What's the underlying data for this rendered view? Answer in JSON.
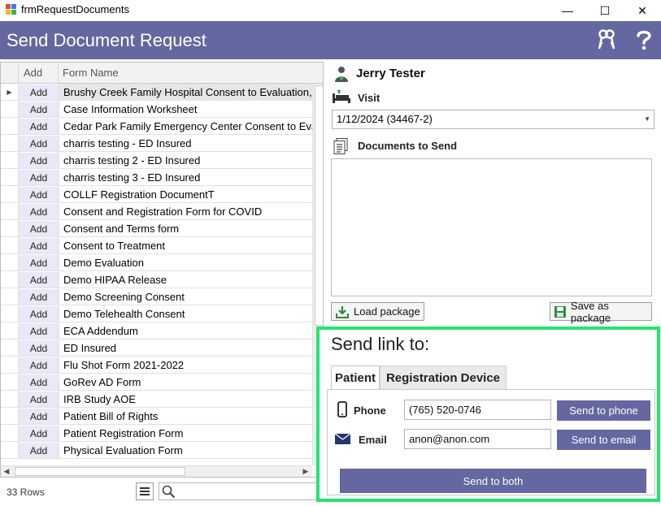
{
  "window": {
    "title": "frmRequestDocuments",
    "minimize": "—",
    "maximize": "☐",
    "close": "✕"
  },
  "header": {
    "title": "Send Document Request",
    "icons": [
      "keys-icon",
      "help-icon"
    ],
    "accent": "#6567a0"
  },
  "grid": {
    "columns": {
      "add": "Add",
      "form_name": "Form Name"
    },
    "row_marker": "▶",
    "rows": [
      {
        "add": "Add",
        "name": "Brushy Creek Family Hospital Consent to Evaluation, I"
      },
      {
        "add": "Add",
        "name": "Case Information Worksheet"
      },
      {
        "add": "Add",
        "name": "Cedar Park  Family Emergency Center Consent to Eva"
      },
      {
        "add": "Add",
        "name": "charris testing - ED Insured"
      },
      {
        "add": "Add",
        "name": "charris testing 2 - ED Insured"
      },
      {
        "add": "Add",
        "name": "charris testing 3 - ED Insured"
      },
      {
        "add": "Add",
        "name": "COLLF Registration DocumentT"
      },
      {
        "add": "Add",
        "name": "Consent and Registration Form for COVID"
      },
      {
        "add": "Add",
        "name": "Consent and Terms form"
      },
      {
        "add": "Add",
        "name": "Consent to Treatment"
      },
      {
        "add": "Add",
        "name": "Demo Evaluation"
      },
      {
        "add": "Add",
        "name": "Demo HIPAA Release"
      },
      {
        "add": "Add",
        "name": "Demo Screening Consent"
      },
      {
        "add": "Add",
        "name": "Demo Telehealth Consent"
      },
      {
        "add": "Add",
        "name": "ECA Addendum"
      },
      {
        "add": "Add",
        "name": "ED Insured"
      },
      {
        "add": "Add",
        "name": "Flu Shot Form 2021-2022"
      },
      {
        "add": "Add",
        "name": "GoRev AD Form"
      },
      {
        "add": "Add",
        "name": "IRB Study AOE"
      },
      {
        "add": "Add",
        "name": "Patient Bill of Rights"
      },
      {
        "add": "Add",
        "name": "Patient Registration Form"
      },
      {
        "add": "Add",
        "name": "Physical Evaluation Form"
      }
    ],
    "row_count": "33 Rows",
    "scroll_left": "◀",
    "scroll_right": "▶"
  },
  "patient": {
    "name": "Jerry Tester",
    "visit_label": "Visit",
    "visit_value": "1/12/2024 (34467-2)",
    "visit_caret": "▼",
    "documents_label": "Documents to Send",
    "load_package": "Load package",
    "save_package": "Save as package"
  },
  "send_link": {
    "title": "Send link to:",
    "tabs": [
      "Patient",
      "Registration Device"
    ],
    "phone_label": "Phone",
    "phone_value": "(765) 520-0746",
    "send_phone": "Send to phone",
    "email_label": "Email",
    "email_value": "anon@anon.com",
    "send_email": "Send to email",
    "send_both": "Send to both",
    "highlight_color": "#27e36f"
  }
}
